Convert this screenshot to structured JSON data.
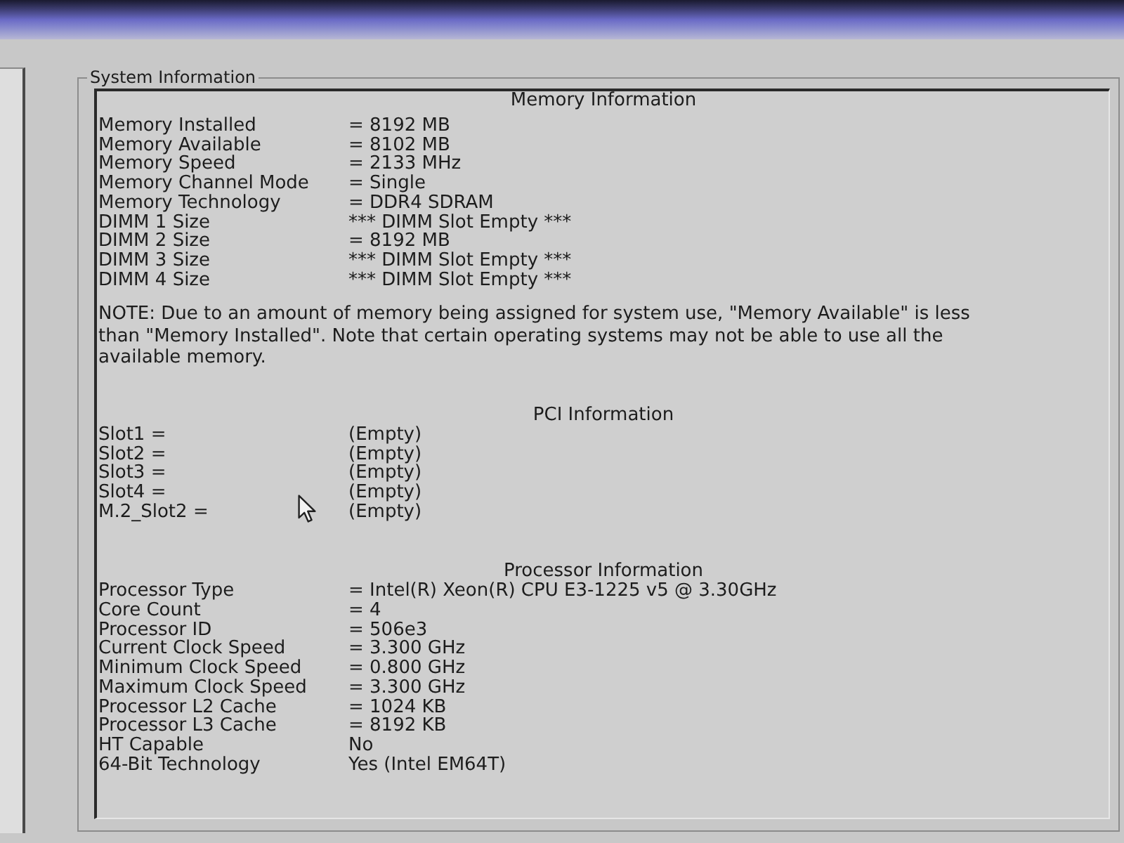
{
  "panel": {
    "legend": "System Information"
  },
  "sections": [
    {
      "heading": "Memory Information",
      "rows": [
        {
          "label": "Memory Installed",
          "value": "= 8192 MB"
        },
        {
          "label": "Memory Available",
          "value": "= 8102 MB"
        },
        {
          "label": "Memory Speed",
          "value": "= 2133 MHz"
        },
        {
          "label": "Memory Channel Mode",
          "value": "= Single"
        },
        {
          "label": "Memory Technology",
          "value": "= DDR4 SDRAM"
        },
        {
          "label": "DIMM 1 Size",
          "value": "*** DIMM Slot Empty ***"
        },
        {
          "label": "DIMM 2 Size",
          "value": "= 8192 MB"
        },
        {
          "label": "DIMM 3 Size",
          "value": "*** DIMM Slot Empty ***"
        },
        {
          "label": "DIMM 4 Size",
          "value": "*** DIMM Slot Empty ***"
        }
      ],
      "note": "NOTE: Due to an amount of memory being assigned for system use, \"Memory Available\" is less than \"Memory Installed\". Note that certain operating systems may not be able to use all the available memory."
    },
    {
      "heading": "PCI Information",
      "rows": [
        {
          "label": "Slot1 =",
          "value": "(Empty)"
        },
        {
          "label": "Slot2 =",
          "value": "(Empty)"
        },
        {
          "label": "Slot3 =",
          "value": "(Empty)"
        },
        {
          "label": "Slot4 =",
          "value": "(Empty)"
        },
        {
          "label": "M.2_Slot2 =",
          "value": "(Empty)"
        }
      ]
    },
    {
      "heading": "Processor Information",
      "rows": [
        {
          "label": "Processor Type",
          "value": "= Intel(R) Xeon(R) CPU E3-1225 v5 @ 3.30GHz"
        },
        {
          "label": "Core Count",
          "value": "= 4"
        },
        {
          "label": "Processor ID",
          "value": "= 506e3"
        },
        {
          "label": "Current Clock Speed",
          "value": "= 3.300 GHz"
        },
        {
          "label": "Minimum Clock Speed",
          "value": "= 0.800 GHz"
        },
        {
          "label": "Maximum Clock Speed",
          "value": "= 3.300 GHz"
        },
        {
          "label": "Processor L2 Cache",
          "value": "= 1024 KB"
        },
        {
          "label": "Processor L3 Cache",
          "value": "= 8192 KB"
        },
        {
          "label": "HT Capable",
          "value": "No"
        },
        {
          "label": "64-Bit Technology",
          "value": "Yes (Intel EM64T)"
        }
      ]
    }
  ]
}
